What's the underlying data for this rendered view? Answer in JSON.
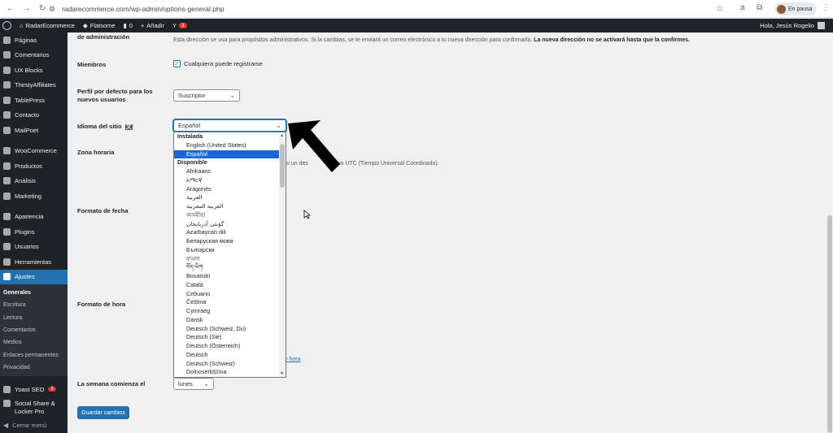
{
  "browser": {
    "url": "radarecommerce.com/wp-admin/options-general.php",
    "profile_status": "En pausa"
  },
  "adminbar": {
    "site_name": "RadarEcommerce",
    "theme": "Flatsome",
    "comments_count": "0",
    "add_new": "Añadir",
    "yoast_count": "3",
    "greeting": "Hola, Jesús Rogelio"
  },
  "sidebar": {
    "items": [
      {
        "label": "Páginas"
      },
      {
        "label": "Comentarios"
      },
      {
        "label": "UX Blocks"
      },
      {
        "label": "ThirstyAffiliates"
      },
      {
        "label": "TablePress"
      },
      {
        "label": "Contacto"
      },
      {
        "label": "MailPoet"
      },
      {
        "label": "WooCommerce"
      },
      {
        "label": "Productos"
      },
      {
        "label": "Análisis"
      },
      {
        "label": "Marketing"
      },
      {
        "label": "Apariencia"
      },
      {
        "label": "Plugins"
      },
      {
        "label": "Usuarios"
      },
      {
        "label": "Herramientas"
      },
      {
        "label": "Ajustes"
      }
    ],
    "submenu": [
      "Generales",
      "Escritura",
      "Lectura",
      "Comentarios",
      "Medios",
      "Enlaces permanentes",
      "Privacidad"
    ],
    "yoast": {
      "label": "Yoast SEO",
      "badge": "3"
    },
    "social": "Social Share & Locker Pro",
    "collapse": "Cerrar menú"
  },
  "form": {
    "admin_label": "de administración",
    "admin_desc": "Esta dirección se usa para propósitos administrativos. Si la cambias, se te enviará un correo electrónico a tu nueva dirección para confirmarla.",
    "admin_desc_bold": "La nueva dirección no se activará hasta que la confirmes.",
    "members_label": "Miembros",
    "members_check": "Cualquiera puede registrarse",
    "role_label_1": "Perfil por defecto para los",
    "role_label_2": "nuevos usuarios",
    "role_value": "Suscriptor",
    "lang_label": "Idioma del sitio",
    "lang_value": "Español",
    "tz_label": "Zona horaria",
    "tz_desc": "o un des... UTC (Tiempo Universal Coordinado).",
    "tz_desc_a": "o un des",
    "tz_desc_b": "so UTC (Tiempo Universal Coordinado).",
    "date_label": "Formato de fecha",
    "time_label": "Formato de hora",
    "time_link": "y hora",
    "week_label": "La semana comienza el",
    "week_value": "lunes",
    "save": "Guardar cambios"
  },
  "dropdown": {
    "installed_group": "Instalada",
    "installed": [
      "English (United States)",
      "Español"
    ],
    "available_group": "Disponible",
    "available": [
      "Afrikaans",
      "አማርኛ",
      "Aragonés",
      "العربية",
      "العربية المغربية",
      "অসমীয়া",
      "گؤنئی آذربایجان",
      "Azərbaycan dili",
      "Беларуская мова",
      "Български",
      "বাংলা",
      "བོད་ཡིག",
      "Bosanski",
      "Català",
      "Cebuano",
      "Čeština",
      "Cymraeg",
      "Dansk",
      "Deutsch (Schweiz, Du)",
      "Deutsch (Sie)",
      "Deutsch (Österreich)",
      "Deutsch",
      "Deutsch (Schweiz)",
      "Dolnoserbšćina"
    ]
  }
}
